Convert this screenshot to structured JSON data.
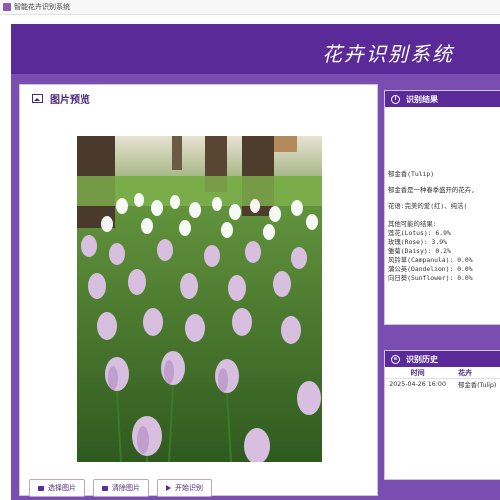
{
  "window": {
    "title": "智能花卉识别系统"
  },
  "app": {
    "title": "花卉识别系统"
  },
  "preview": {
    "title": "图片预览"
  },
  "buttons": {
    "select": "选择图片",
    "clear": "清除图片",
    "start": "开始识别"
  },
  "result": {
    "title": "识别结果",
    "lines": [
      "郁金香(Tulip)",
      "郁金香是一种春季盛开的花卉,",
      "花语:完美的爱(红)、纯洁(",
      "其他可能的结果:",
      "莲花(Lotus): 6.9%",
      "玫瑰(Rose): 3.9%",
      "雏菊(Daisy): 0.2%",
      "风铃草(Campanula): 0.0%",
      "蒲公英(Dandelion): 0.0%",
      "向日葵(Sunflower): 0.0%"
    ]
  },
  "history": {
    "title": "识别历史",
    "columns": [
      "时间",
      "花卉"
    ],
    "rows": [
      {
        "time": "2025-04-26 16:00",
        "flower": "郁金香(Tulip)"
      }
    ]
  },
  "colors": {
    "purple_dark": "#5b2a99",
    "purple_mid": "#7a4db1"
  }
}
